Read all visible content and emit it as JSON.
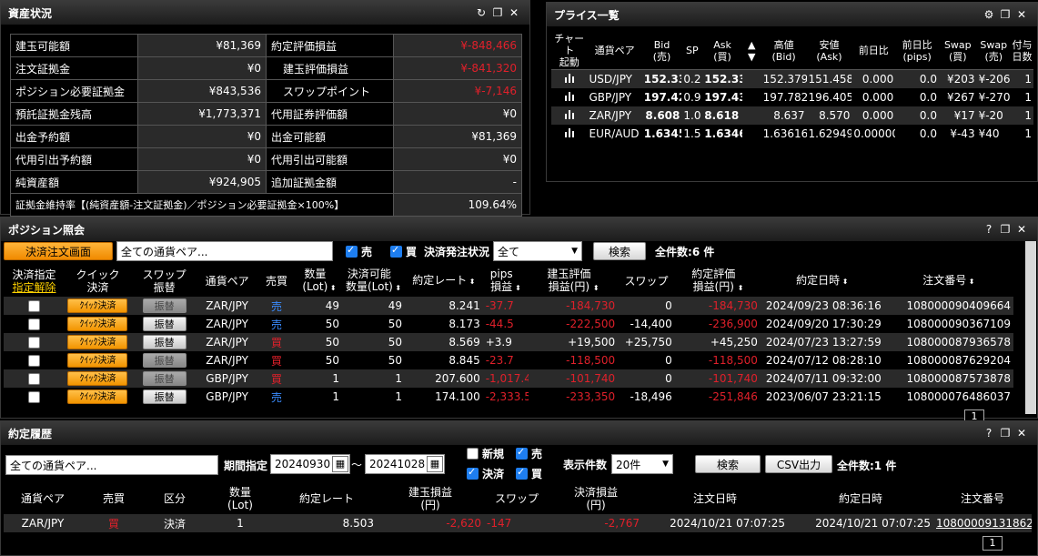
{
  "asset": {
    "title": "資産状況",
    "rows": [
      {
        "l1": "建玉可能額",
        "v1": "¥81,369",
        "l2": "約定評価損益",
        "v2": "¥-848,466",
        "c2": "red",
        "indent2": false
      },
      {
        "l1": "注文証拠金",
        "v1": "¥0",
        "l2": "建玉評価損益",
        "v2": "¥-841,320",
        "c2": "red",
        "indent2": true
      },
      {
        "l1": "ポジション必要証拠金",
        "v1": "¥843,536",
        "l2": "スワップポイント",
        "v2": "¥-7,146",
        "c2": "red",
        "indent2": true
      },
      {
        "l1": "預託証拠金残高",
        "v1": "¥1,773,371",
        "l2": "代用証券評価額",
        "v2": "¥0",
        "c2": "",
        "indent2": false
      },
      {
        "l1": "出金予約額",
        "v1": "¥0",
        "l2": "出金可能額",
        "v2": "¥81,369",
        "c2": "",
        "indent2": false
      },
      {
        "l1": "代用引出予約額",
        "v1": "¥0",
        "l2": "代用引出可能額",
        "v2": "¥0",
        "c2": "",
        "indent2": false
      },
      {
        "l1": "純資産額",
        "v1": "¥924,905",
        "l2": "追加証拠金額",
        "v2": "-",
        "c2": "",
        "indent2": false
      }
    ],
    "ratio_label": "証拠金維持率【(純資産額-注文証拠金)／ポジション必要証拠金×100%】",
    "ratio_value": "109.64%"
  },
  "price": {
    "title": "プライス一覧",
    "headers": [
      "チャート\n起動",
      "通貨ペア",
      "Bid\n(売)",
      "SP",
      "Ask\n(買)",
      "▲\n▼",
      "高値\n(Bid)",
      "安値\n(Ask)",
      "前日比",
      "前日比\n(pips)",
      "Swap\n(買)",
      "Swap\n(売)",
      "付与\n日数"
    ],
    "rows": [
      {
        "pair": "USD/JPY",
        "bid": "152.331",
        "sp": "0.2",
        "ask": "152.33",
        "high": "152.379",
        "low": "151.458",
        "chg": "0.000",
        "pips": "0.0",
        "swb": "¥203",
        "sws": "¥-206",
        "days": "1"
      },
      {
        "pair": "GBP/JPY",
        "bid": "197.426",
        "sp": "0.9",
        "ask": "197.43",
        "high": "197.782",
        "low": "196.405",
        "chg": "0.000",
        "pips": "0.0",
        "swb": "¥267",
        "sws": "¥-270",
        "days": "1"
      },
      {
        "pair": "ZAR/JPY",
        "bid": "8.608",
        "sp": "1.0",
        "ask": "8.618",
        "high": "8.637",
        "low": "8.570",
        "chg": "0.000",
        "pips": "0.0",
        "swb": "¥17",
        "sws": "¥-20",
        "days": "1"
      },
      {
        "pair": "EUR/AUD",
        "bid": "1.63452",
        "sp": "1.5",
        "ask": "1.6346",
        "high": "1.63616",
        "low": "1.62949",
        "chg": "0.00000",
        "pips": "0.0",
        "swb": "¥-43",
        "sws": "¥40",
        "days": "1"
      }
    ]
  },
  "position": {
    "title": "ポジション照会",
    "settle_btn": "決済注文画面",
    "pair_select": "全ての通貨ペア...",
    "sell_label": "売",
    "buy_label": "買",
    "status_label": "決済発注状況",
    "status_value": "全て",
    "search_btn": "検索",
    "count": "全件数:6 件",
    "headers": [
      "決済指定",
      "クイック\n決済",
      "スワップ\n振替",
      "通貨ペア",
      "売買",
      "数量\n(Lot)",
      "決済可能\n数量(Lot)",
      "約定レート",
      "pips\n損益",
      "建玉評価\n損益(円)",
      "スワップ",
      "約定評価\n損益(円)",
      "約定日時",
      "注文番号"
    ],
    "cancel_link": "指定解除",
    "quick_label": "ｸｲｯｸ決済",
    "transfer_label": "振替",
    "rows": [
      {
        "pair": "ZAR/JPY",
        "side": "売",
        "side_c": "blue",
        "qty": "49",
        "avail": "49",
        "rate": "8.241",
        "pips": "-37.7",
        "pips_c": "red",
        "eval": "-184,730",
        "eval_c": "red",
        "swap": "0",
        "total": "-184,730",
        "total_c": "red",
        "date": "2024/09/23 08:36:16",
        "no": "108000090409664",
        "dis": true
      },
      {
        "pair": "ZAR/JPY",
        "side": "売",
        "side_c": "blue",
        "qty": "50",
        "avail": "50",
        "rate": "8.173",
        "pips": "-44.5",
        "pips_c": "red",
        "eval": "-222,500",
        "eval_c": "red",
        "swap": "-14,400",
        "total": "-236,900",
        "total_c": "red",
        "date": "2024/09/20 17:30:29",
        "no": "108000090367109",
        "dis": false
      },
      {
        "pair": "ZAR/JPY",
        "side": "買",
        "side_c": "red",
        "qty": "50",
        "avail": "50",
        "rate": "8.569",
        "pips": "+3.9",
        "pips_c": "",
        "eval": "+19,500",
        "eval_c": "",
        "swap": "+25,750",
        "total": "+45,250",
        "total_c": "",
        "date": "2024/07/23 13:27:59",
        "no": "108000087936578",
        "dis": false
      },
      {
        "pair": "ZAR/JPY",
        "side": "買",
        "side_c": "red",
        "qty": "50",
        "avail": "50",
        "rate": "8.845",
        "pips": "-23.7",
        "pips_c": "red",
        "eval": "-118,500",
        "eval_c": "red",
        "swap": "0",
        "total": "-118,500",
        "total_c": "red",
        "date": "2024/07/12 08:28:10",
        "no": "108000087629204",
        "dis": true
      },
      {
        "pair": "GBP/JPY",
        "side": "買",
        "side_c": "red",
        "qty": "1",
        "avail": "1",
        "rate": "207.600",
        "pips": "-1,017.4",
        "pips_c": "red",
        "eval": "-101,740",
        "eval_c": "red",
        "swap": "0",
        "total": "-101,740",
        "total_c": "red",
        "date": "2024/07/11 09:32:00",
        "no": "108000087573878",
        "dis": true
      },
      {
        "pair": "GBP/JPY",
        "side": "売",
        "side_c": "blue",
        "qty": "1",
        "avail": "1",
        "rate": "174.100",
        "pips": "-2,333.5",
        "pips_c": "red",
        "eval": "-233,350",
        "eval_c": "red",
        "swap": "-18,496",
        "total": "-251,846",
        "total_c": "red",
        "date": "2023/06/07 23:21:15",
        "no": "108000076486037",
        "dis": false
      }
    ],
    "page": "1"
  },
  "history": {
    "title": "約定履歴",
    "pair_select": "全ての通貨ペア...",
    "period_label": "期間指定",
    "from": "20240930",
    "tilde": "〜",
    "to": "20241028",
    "new_label": "新規",
    "sell_label": "売",
    "settle_label": "決済",
    "buy_label": "買",
    "show_label": "表示件数",
    "show_value": "20件",
    "search_btn": "検索",
    "csv_btn": "CSV出力",
    "count": "全件数:1 件",
    "headers": [
      "通貨ペア",
      "売買",
      "区分",
      "数量\n(Lot)",
      "約定レート",
      "建玉損益\n(円)",
      "スワップ",
      "決済損益\n(円)",
      "注文日時",
      "約定日時",
      "注文番号"
    ],
    "rows": [
      {
        "pair": "ZAR/JPY",
        "side": "買",
        "kind": "決済",
        "qty": "1",
        "rate": "8.503",
        "pl": "-2,620",
        "swap": "-147",
        "total": "-2,767",
        "odate": "2024/10/21 07:07:25",
        "edate": "2024/10/21 07:07:25",
        "no": "108000091318624"
      }
    ],
    "page": "1"
  },
  "colors": {
    "red": "#e0202a",
    "blue": "#3a8cff",
    "orange": "#f29400",
    "bg": "#000000",
    "row_alt": "#2a2a2a"
  }
}
